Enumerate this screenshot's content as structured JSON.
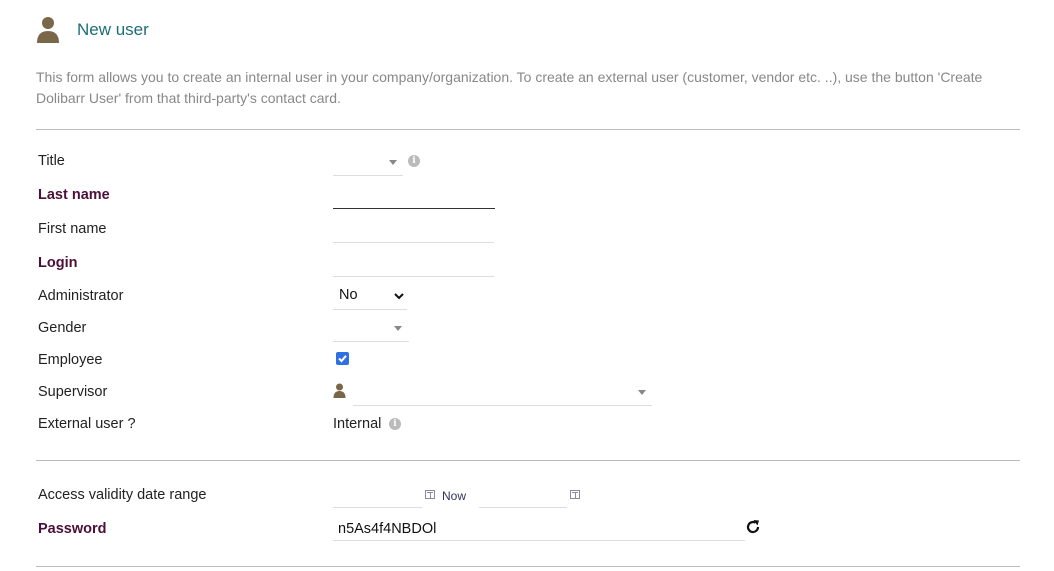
{
  "header": {
    "title": "New user",
    "icon": "user-icon"
  },
  "description": "This form allows you to create an internal user in your company/organization. To create an external user (customer, vendor etc. ..), use the button 'Create Dolibarr User' from that third-party's contact card.",
  "form": {
    "title_label": "Title",
    "title_value": "",
    "lastname_label": "Last name",
    "lastname_value": "",
    "firstname_label": "First name",
    "firstname_value": "",
    "login_label": "Login",
    "login_value": "",
    "admin_label": "Administrator",
    "admin_value": "No",
    "gender_label": "Gender",
    "gender_value": "",
    "employee_label": "Employee",
    "employee_checked": true,
    "supervisor_label": "Supervisor",
    "supervisor_value": "",
    "external_label": "External user ?",
    "external_value": "Internal",
    "validity_label": "Access validity date range",
    "validity_start": "",
    "validity_now": "Now",
    "validity_end": "",
    "password_label": "Password",
    "password_value": "n5As4f4NBDOl"
  },
  "colors": {
    "accent": "#1c6e76",
    "required": "#4b1038",
    "user_icon": "#7a6648"
  }
}
